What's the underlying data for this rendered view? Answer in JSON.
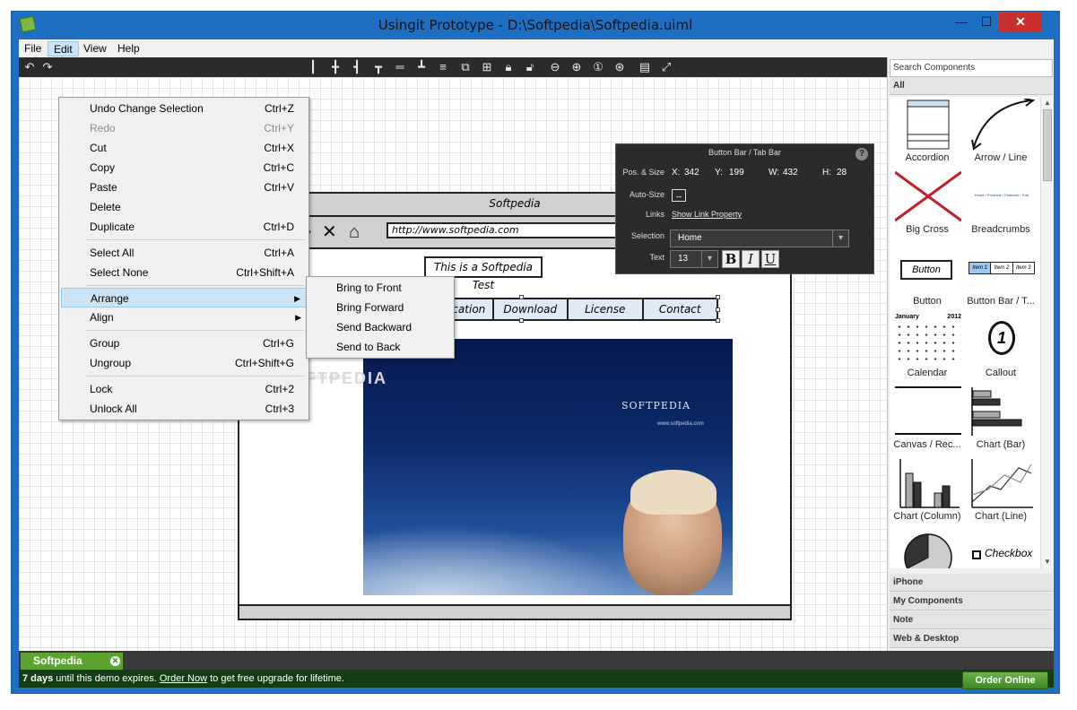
{
  "window": {
    "title": "Usingit Prototype - D:\\Softpedia\\Softpedia.uiml",
    "minimize_glyph": "—",
    "maximize_glyph": "☐",
    "close_glyph": "✕"
  },
  "menubar": {
    "items": [
      "File",
      "Edit",
      "View",
      "Help"
    ],
    "active": "Edit"
  },
  "edit_menu": {
    "items": [
      {
        "label": "Undo Change Selection",
        "shortcut": "Ctrl+Z"
      },
      {
        "label": "Redo",
        "shortcut": "Ctrl+Y",
        "disabled": true
      },
      {
        "label": "Cut",
        "shortcut": "Ctrl+X"
      },
      {
        "label": "Copy",
        "shortcut": "Ctrl+C"
      },
      {
        "label": "Paste",
        "shortcut": "Ctrl+V"
      },
      {
        "label": "Delete",
        "shortcut": ""
      },
      {
        "label": "Duplicate",
        "shortcut": "Ctrl+D"
      },
      {
        "label": "Select All",
        "shortcut": "Ctrl+A"
      },
      {
        "label": "Select None",
        "shortcut": "Ctrl+Shift+A"
      },
      {
        "label": "Arrange",
        "shortcut": "",
        "submenu": true
      },
      {
        "label": "Align",
        "shortcut": "",
        "submenu": true
      },
      {
        "label": "Group",
        "shortcut": "Ctrl+G"
      },
      {
        "label": "Ungroup",
        "shortcut": "Ctrl+Shift+G"
      },
      {
        "label": "Lock",
        "shortcut": "Ctrl+2"
      },
      {
        "label": "Unlock All",
        "shortcut": "Ctrl+3"
      }
    ],
    "submenu_arrow": "▶"
  },
  "arrange_submenu": {
    "items": [
      "Bring to Front",
      "Bring Forward",
      "Send Backward",
      "Send to Back"
    ]
  },
  "toolbar": {
    "icons": [
      "undo-icon",
      "redo-icon",
      "align-left-icon",
      "align-center-icon",
      "align-right-icon",
      "align-top-icon",
      "align-middle-icon",
      "align-bottom-icon",
      "group-icon",
      "ungroup-icon",
      "lock-icon",
      "unlock-icon",
      "zoom-out-icon",
      "zoom-in-icon",
      "zoom-actual-icon",
      "zoom-fit-icon",
      "notes-icon",
      "fullscreen-icon"
    ]
  },
  "mockup": {
    "title": "Softpedia",
    "url": "http://www.softpedia.com",
    "label": "This is a Softpedia Test",
    "tabs": [
      "Application",
      "Download",
      "License",
      "Contact"
    ],
    "photo_logo": "SOFTPEDIA",
    "photo_sub": "www.softpedia.com",
    "watermark": "SOFTPEDIA",
    "watermark_sub": "www.softpedia.com"
  },
  "properties": {
    "title": "Button Bar / Tab Bar",
    "help": "?",
    "pos_label": "Pos. & Size",
    "x_label": "X:",
    "x": "342",
    "y_label": "Y:",
    "y": "199",
    "w_label": "W:",
    "w": "432",
    "h_label": "H:",
    "h": "28",
    "autosize_label": "Auto-Size",
    "links_label": "Links",
    "links_value": "Show Link Property",
    "selection_label": "Selection",
    "selection_value": "Home",
    "text_label": "Text",
    "font_size": "13",
    "bold": "B",
    "italic": "I",
    "underline": "U",
    "dropdown_arrow": "▾"
  },
  "components_panel": {
    "search_placeholder": "Search Components",
    "all_label": "All",
    "components": [
      "Accordion",
      "Arrow / Line",
      "Big Cross",
      "Breadcrumbs",
      "Button",
      "Button Bar / T...",
      "Calendar",
      "Callout",
      "Canvas / Rec...",
      "Chart (Bar)",
      "Chart (Column)",
      "Chart (Line)",
      "",
      "Checkbox"
    ],
    "categories": [
      "iPhone",
      "My Components",
      "Note",
      "Web & Desktop"
    ],
    "thumb_text": {
      "button": "Button",
      "buttonbar": [
        "Item 1",
        "Item 2",
        "Item 3"
      ],
      "breadcrumbs": "Home › Products › Features › Tour",
      "calendar_month": "January",
      "calendar_year": "2012",
      "callout": "1"
    }
  },
  "doc_tab": {
    "label": "Softpedia",
    "close": "✕"
  },
  "status": {
    "days": "7 days",
    "text1": " until this demo expires. ",
    "order_link": "Order Now",
    "text2": " to get free upgrade for lifetime.",
    "order_button": "Order Online"
  }
}
